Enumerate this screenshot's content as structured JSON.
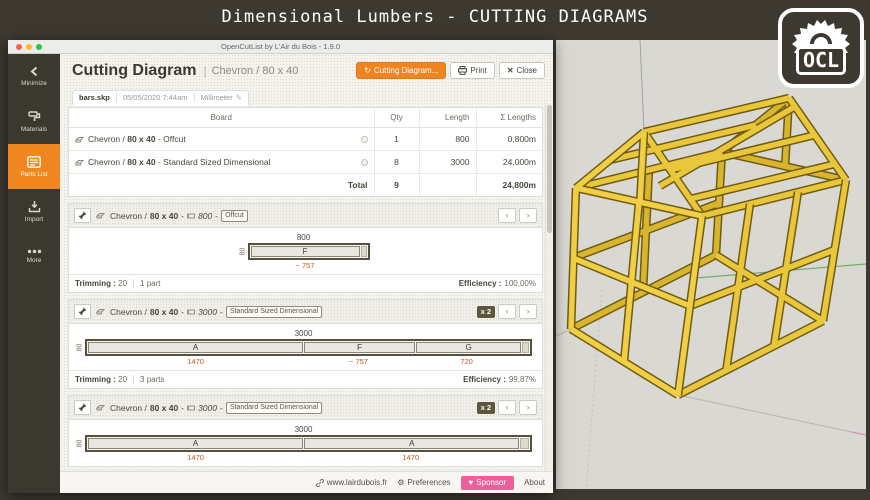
{
  "page_title": "Dimensional Lumbers - CUTTING DIAGRAMS",
  "logo_text": "OCL",
  "sep": "-",
  "window": {
    "titlebar_title": "OpenCutList by L'Air du Bois - 1.9.0",
    "sidebar": {
      "items": [
        {
          "label": "Minimize"
        },
        {
          "label": "Materials"
        },
        {
          "label": "Parts List"
        },
        {
          "label": "Import"
        },
        {
          "label": "More"
        }
      ]
    },
    "header": {
      "title": "Cutting Diagram",
      "separator": "|",
      "subtitle": "Chevron / 80 x 40",
      "buttons": {
        "generate": "Cutting Diagram...",
        "print": "Print",
        "close": "Close"
      }
    },
    "tab": {
      "filename": "bars.skp",
      "timestamp": "05/05/2020 7:44am",
      "unit": "Millimeter"
    },
    "summary_table": {
      "columns": [
        "Board",
        "Qty",
        "Length",
        "Σ Lengths"
      ],
      "rows": [
        {
          "board_prefix": "Chevron /",
          "board_bold": "80 x 40",
          "board_suffix": "- Offcut",
          "qty": "1",
          "length": "800",
          "total_length": "0,800m"
        },
        {
          "board_prefix": "Chevron /",
          "board_bold": "80 x 40",
          "board_suffix": "- Standard Sized Dimensional",
          "qty": "8",
          "length": "3000",
          "total_length": "24,000m"
        }
      ],
      "total_label": "Total",
      "total_qty": "9",
      "total_sum": "24,800m"
    },
    "sections": [
      {
        "name_prefix": "Chevron /",
        "name_bold": "80 x 40",
        "length": "800",
        "tag": "Offcut",
        "width_label": "80",
        "length_label": "800",
        "parts": [
          {
            "label": "F",
            "size": "~ 757"
          }
        ],
        "trimming_label": "Trimming :",
        "trimming_value": "20",
        "count": "1 part",
        "efficiency_label": "Efficiency :",
        "efficiency_value": "100,00%"
      },
      {
        "name_prefix": "Chevron /",
        "name_bold": "80 x 40",
        "length": "3000",
        "tag": "Standard Sized Dimensional",
        "multiplier": "x 2",
        "width_label": "80",
        "length_label": "3000",
        "parts": [
          {
            "label": "A",
            "size": "1470"
          },
          {
            "label": "F",
            "size": "~ 757"
          },
          {
            "label": "G",
            "size": "720"
          }
        ],
        "trimming_label": "Trimming :",
        "trimming_value": "20",
        "count": "3 parts",
        "efficiency_label": "Efficiency :",
        "efficiency_value": "99,87%"
      },
      {
        "name_prefix": "Chevron /",
        "name_bold": "80 x 40",
        "length": "3000",
        "tag": "Standard Sized Dimensional",
        "multiplier": "x 2",
        "width_label": "80",
        "length_label": "3000",
        "parts": [
          {
            "label": "A",
            "size": "1470"
          },
          {
            "label": "A",
            "size": "1470"
          }
        ]
      }
    ],
    "footer": {
      "website": "www.lairdubois.fr",
      "preferences": "Preferences",
      "sponsor": "Sponsor",
      "about": "About"
    }
  }
}
